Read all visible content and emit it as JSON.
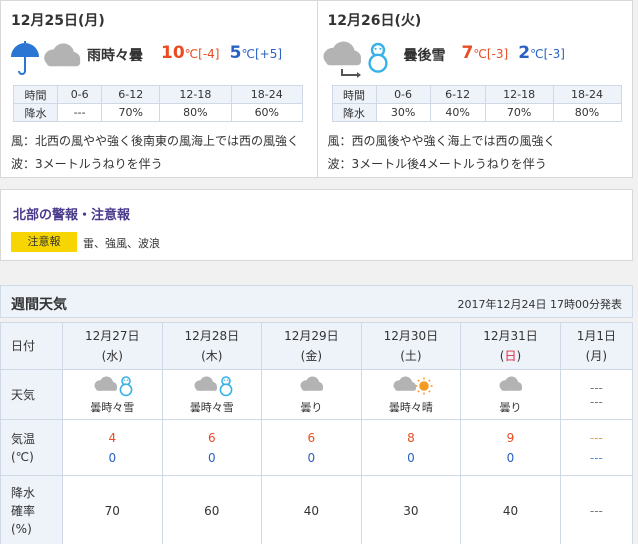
{
  "days": [
    {
      "date": "12月25日(月)",
      "icon": "umbrella-cloud-icon",
      "weather": "雨時々曇",
      "high": "10",
      "high_unit": "℃",
      "high_diff": "[-4]",
      "low": "5",
      "low_unit": "℃",
      "low_diff": "[+5]",
      "rain_table": {
        "header_label": "時間",
        "row_label": "降水",
        "periods": [
          "0-6",
          "6-12",
          "12-18",
          "18-24"
        ],
        "values": [
          "---",
          "70%",
          "80%",
          "60%"
        ]
      },
      "wind": "風：北西の風やや強く後南東の風海上では西の風強く",
      "wave": "波：3メートルうねりを伴う"
    },
    {
      "date": "12月26日(火)",
      "icon": "cloud-then-snow-icon",
      "weather": "曇後雪",
      "high": "7",
      "high_unit": "℃",
      "high_diff": "[-3]",
      "low": "2",
      "low_unit": "℃",
      "low_diff": "[-3]",
      "rain_table": {
        "header_label": "時間",
        "row_label": "降水",
        "periods": [
          "0-6",
          "6-12",
          "12-18",
          "18-24"
        ],
        "values": [
          "30%",
          "40%",
          "70%",
          "80%"
        ]
      },
      "wind": "風：西の風後やや強く海上では西の風強く",
      "wave": "波：3メートル後4メートルうねりを伴う"
    }
  ],
  "warnings": {
    "title": "北部の警報・注意報",
    "badge": "注意報",
    "items": "雷、強風、波浪"
  },
  "weekly": {
    "title": "週間天気",
    "issued": "2017年12月24日 17時00分発表",
    "labels": {
      "date": "日付",
      "weather": "天気",
      "temp_line1": "気温",
      "temp_line2": "(℃)",
      "rain_line1": "降水",
      "rain_line2": "確率",
      "rain_line3": "(%)"
    },
    "days": [
      {
        "date": "12月27日",
        "dow": "(水)",
        "icon": "cloud-snow-icon",
        "weather": "曇時々雪",
        "high": "4",
        "low": "0",
        "rain": "70"
      },
      {
        "date": "12月28日",
        "dow": "(木)",
        "icon": "cloud-snow-icon",
        "weather": "曇時々雪",
        "high": "6",
        "low": "0",
        "rain": "60"
      },
      {
        "date": "12月29日",
        "dow": "(金)",
        "icon": "cloud-icon",
        "weather": "曇り",
        "high": "6",
        "low": "0",
        "rain": "40"
      },
      {
        "date": "12月30日",
        "dow": "(土)",
        "icon": "cloud-sun-icon",
        "weather": "曇時々晴",
        "high": "8",
        "low": "0",
        "rain": "30"
      },
      {
        "date": "12月31日",
        "dow_open": "(",
        "dow_char": "日",
        "dow_close": ")",
        "icon": "cloud-icon",
        "weather": "曇り",
        "high": "9",
        "low": "0",
        "rain": "40"
      },
      {
        "date": "1月1日",
        "dow": "(月)",
        "weather_dash1": "---",
        "weather_dash2": "---",
        "high": "---",
        "low": "---",
        "rain": "---"
      }
    ]
  },
  "colors": {
    "high": "#e94b22",
    "low": "#2a62c4",
    "warning_badge": "#f6d500",
    "warning_title": "#4b3a8c",
    "sunday": "#e0283a"
  }
}
